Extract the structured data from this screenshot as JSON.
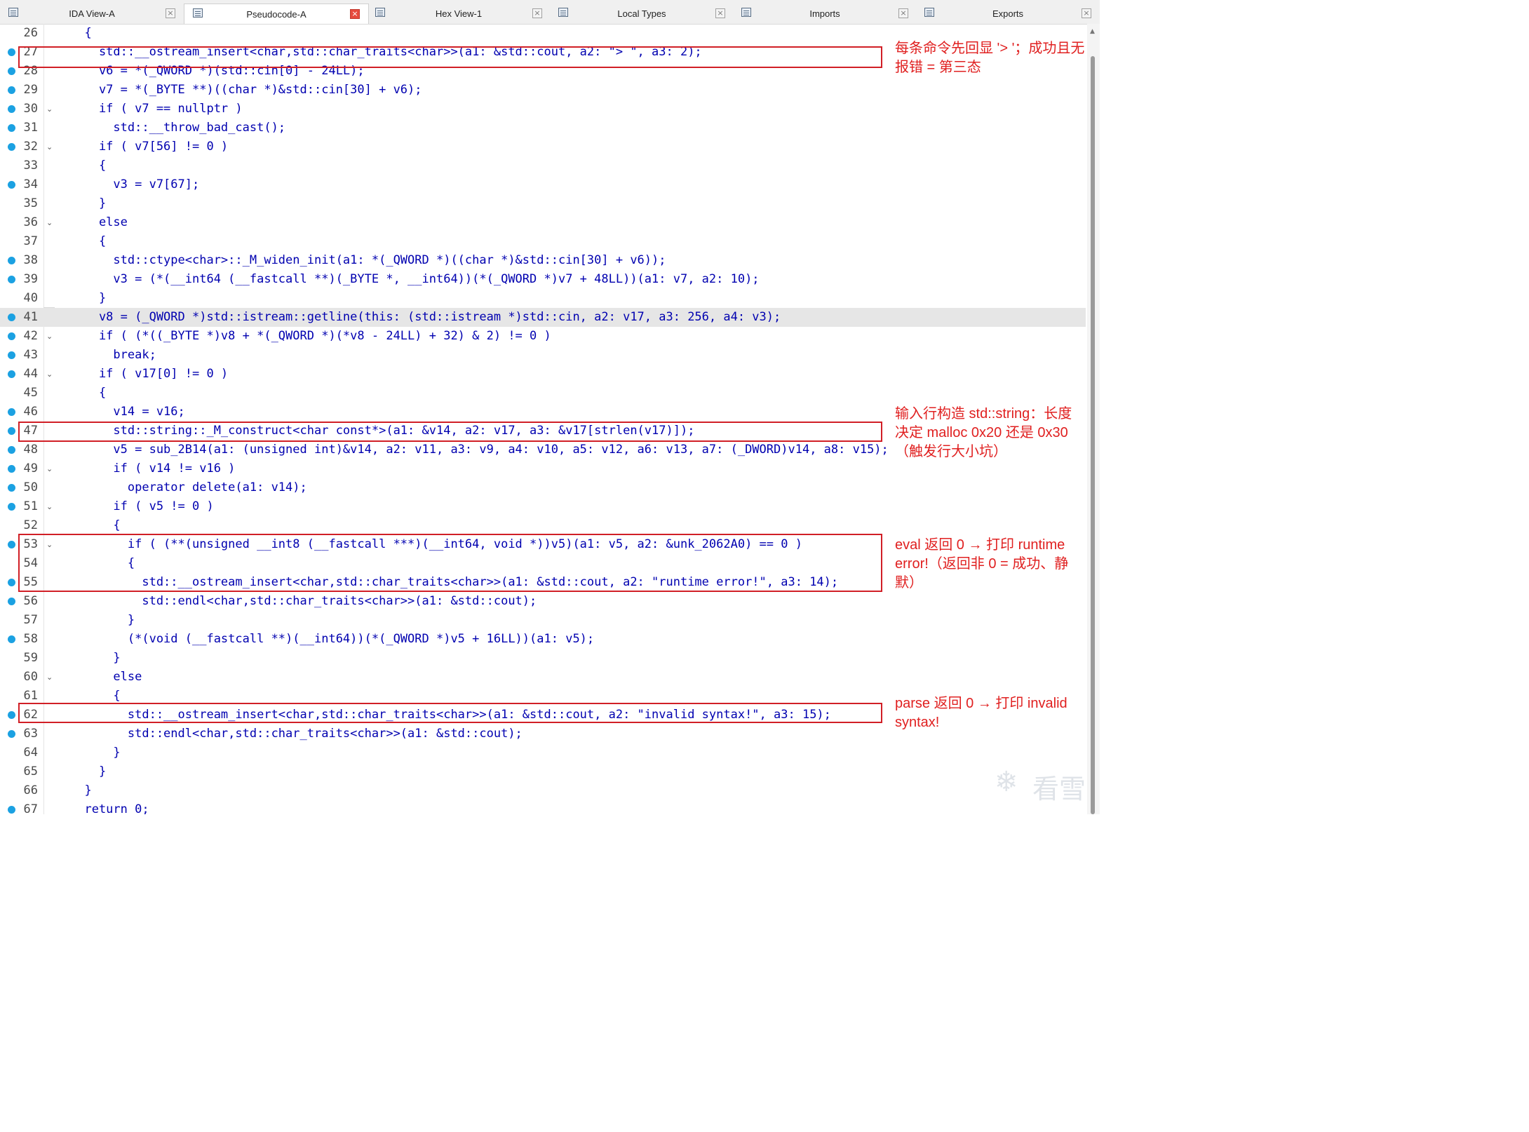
{
  "tabs": [
    {
      "label": "IDA View-A",
      "active": false
    },
    {
      "label": "Pseudocode-A",
      "active": true
    },
    {
      "label": "Hex View-1",
      "active": false
    },
    {
      "label": "Local Types",
      "active": false
    },
    {
      "label": "Imports",
      "active": false
    },
    {
      "label": "Exports",
      "active": false
    }
  ],
  "close_glyph": "×",
  "fold_glyph": "⌄",
  "colors": {
    "accent": "#1ba1e2",
    "annotation": "#e02020"
  },
  "code_lines": [
    {
      "num": "26",
      "dot": false,
      "fold": false,
      "text": "  {"
    },
    {
      "num": "27",
      "dot": true,
      "fold": false,
      "text": "    std::__ostream_insert<char,std::char_traits<char>>(a1: &std::cout, a2: \"> \", a3: 2);"
    },
    {
      "num": "28",
      "dot": true,
      "fold": false,
      "text": "    v6 = *(_QWORD *)(std::cin[0] - 24LL);"
    },
    {
      "num": "29",
      "dot": true,
      "fold": false,
      "text": "    v7 = *(_BYTE **)((char *)&std::cin[30] + v6);"
    },
    {
      "num": "30",
      "dot": true,
      "fold": true,
      "text": "    if ( v7 == nullptr )"
    },
    {
      "num": "31",
      "dot": true,
      "fold": false,
      "text": "      std::__throw_bad_cast();"
    },
    {
      "num": "32",
      "dot": true,
      "fold": true,
      "text": "    if ( v7[56] != 0 )"
    },
    {
      "num": "33",
      "dot": false,
      "fold": false,
      "text": "    {"
    },
    {
      "num": "34",
      "dot": true,
      "fold": false,
      "text": "      v3 = v7[67];"
    },
    {
      "num": "35",
      "dot": false,
      "fold": false,
      "text": "    }"
    },
    {
      "num": "36",
      "dot": false,
      "fold": true,
      "text": "    else"
    },
    {
      "num": "37",
      "dot": false,
      "fold": false,
      "text": "    {"
    },
    {
      "num": "38",
      "dot": true,
      "fold": false,
      "text": "      std::ctype<char>::_M_widen_init(a1: *(_QWORD *)((char *)&std::cin[30] + v6));"
    },
    {
      "num": "39",
      "dot": true,
      "fold": false,
      "text": "      v3 = (*(__int64 (__fastcall **)(_BYTE *, __int64))(*(_QWORD *)v7 + 48LL))(a1: v7, a2: 10);"
    },
    {
      "num": "40",
      "dot": false,
      "fold": false,
      "text": "    }"
    },
    {
      "num": "41",
      "dot": true,
      "fold": false,
      "text": "    v8 = (_QWORD *)std::istream::getline(this: (std::istream *)std::cin, a2: v17, a3: 256, a4: v3);"
    },
    {
      "num": "42",
      "dot": true,
      "fold": true,
      "text": "    if ( (*((_BYTE *)v8 + *(_QWORD *)(*v8 - 24LL) + 32) & 2) != 0 )"
    },
    {
      "num": "43",
      "dot": true,
      "fold": false,
      "text": "      break;"
    },
    {
      "num": "44",
      "dot": true,
      "fold": true,
      "text": "    if ( v17[0] != 0 )"
    },
    {
      "num": "45",
      "dot": false,
      "fold": false,
      "text": "    {"
    },
    {
      "num": "46",
      "dot": true,
      "fold": false,
      "text": "      v14 = v16;"
    },
    {
      "num": "47",
      "dot": true,
      "fold": false,
      "text": "      std::string::_M_construct<char const*>(a1: &v14, a2: v17, a3: &v17[strlen(v17)]);"
    },
    {
      "num": "48",
      "dot": true,
      "fold": false,
      "text": "      v5 = sub_2B14(a1: (unsigned int)&v14, a2: v11, a3: v9, a4: v10, a5: v12, a6: v13, a7: (_DWORD)v14, a8: v15);"
    },
    {
      "num": "49",
      "dot": true,
      "fold": true,
      "text": "      if ( v14 != v16 )"
    },
    {
      "num": "50",
      "dot": true,
      "fold": false,
      "text": "        operator delete(a1: v14);"
    },
    {
      "num": "51",
      "dot": true,
      "fold": true,
      "text": "      if ( v5 != 0 )"
    },
    {
      "num": "52",
      "dot": false,
      "fold": false,
      "text": "      {"
    },
    {
      "num": "53",
      "dot": true,
      "fold": true,
      "text": "        if ( (**(unsigned __int8 (__fastcall ***)(__int64, void *))v5)(a1: v5, a2: &unk_2062A0) == 0 )"
    },
    {
      "num": "54",
      "dot": false,
      "fold": false,
      "text": "        {"
    },
    {
      "num": "55",
      "dot": true,
      "fold": false,
      "text": "          std::__ostream_insert<char,std::char_traits<char>>(a1: &std::cout, a2: \"runtime error!\", a3: 14);"
    },
    {
      "num": "56",
      "dot": true,
      "fold": false,
      "text": "          std::endl<char,std::char_traits<char>>(a1: &std::cout);"
    },
    {
      "num": "57",
      "dot": false,
      "fold": false,
      "text": "        }"
    },
    {
      "num": "58",
      "dot": true,
      "fold": false,
      "text": "        (*(void (__fastcall **)(__int64))(*(_QWORD *)v5 + 16LL))(a1: v5);"
    },
    {
      "num": "59",
      "dot": false,
      "fold": false,
      "text": "      }"
    },
    {
      "num": "60",
      "dot": false,
      "fold": true,
      "text": "      else"
    },
    {
      "num": "61",
      "dot": false,
      "fold": false,
      "text": "      {"
    },
    {
      "num": "62",
      "dot": true,
      "fold": false,
      "text": "        std::__ostream_insert<char,std::char_traits<char>>(a1: &std::cout, a2: \"invalid syntax!\", a3: 15);"
    },
    {
      "num": "63",
      "dot": true,
      "fold": false,
      "text": "        std::endl<char,std::char_traits<char>>(a1: &std::cout);"
    },
    {
      "num": "64",
      "dot": false,
      "fold": false,
      "text": "      }"
    },
    {
      "num": "65",
      "dot": false,
      "fold": false,
      "text": "    }"
    },
    {
      "num": "66",
      "dot": false,
      "fold": false,
      "text": "  }"
    },
    {
      "num": "67",
      "dot": true,
      "fold": false,
      "text": "  return 0;"
    }
  ],
  "highlighted_line": "41",
  "annotations": [
    {
      "text": "每条命令先回显 '> '；成功且无报错 = 第三态"
    },
    {
      "text": "输入行构造 std::string：长度决定 malloc 0x20 还是 0x30（触发行大小坑）"
    },
    {
      "text": "eval 返回 0 → 打印 runtime error!（返回非 0 = 成功、静默）"
    },
    {
      "text": "parse 返回 0 → 打印 invalid syntax!"
    }
  ],
  "watermark": {
    "symbol": "❄",
    "text": "看雪"
  }
}
